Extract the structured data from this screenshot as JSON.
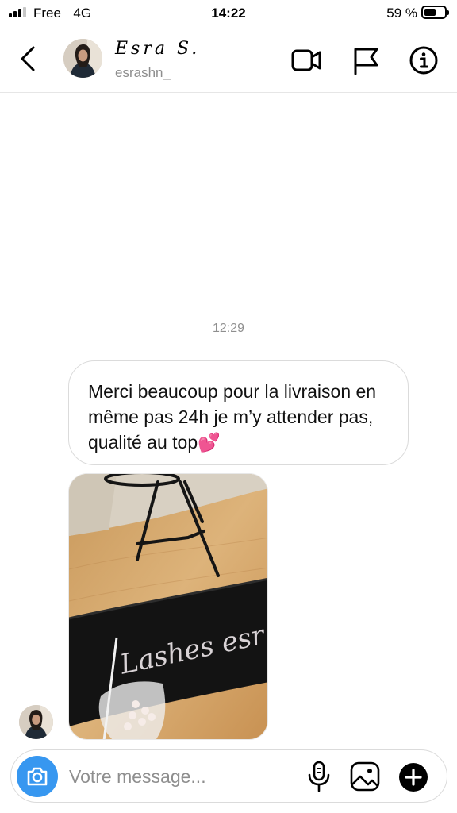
{
  "status_bar": {
    "carrier": "Free",
    "network": "4G",
    "time": "14:22",
    "battery": "59 %",
    "battery_level": 0.59
  },
  "header": {
    "display_name": "Esra S.",
    "username": "esrashn_",
    "icons": [
      "back-chevron-icon",
      "video-call-icon",
      "flag-icon",
      "info-icon"
    ]
  },
  "conversation": {
    "timestamp": "12:29",
    "message_text": "Merci beaucoup pour la livraison en même pas 24h je m’y attender pas, qualité au top💕",
    "photo_caption_visible": "Lashes esr"
  },
  "composer": {
    "placeholder": "Votre message...",
    "icons": [
      "camera-icon",
      "microphone-icon",
      "gallery-icon",
      "add-icon"
    ]
  },
  "colors": {
    "accent": "#3797f0",
    "muted_text": "#8e8e8e",
    "border": "#dbdbdb"
  }
}
